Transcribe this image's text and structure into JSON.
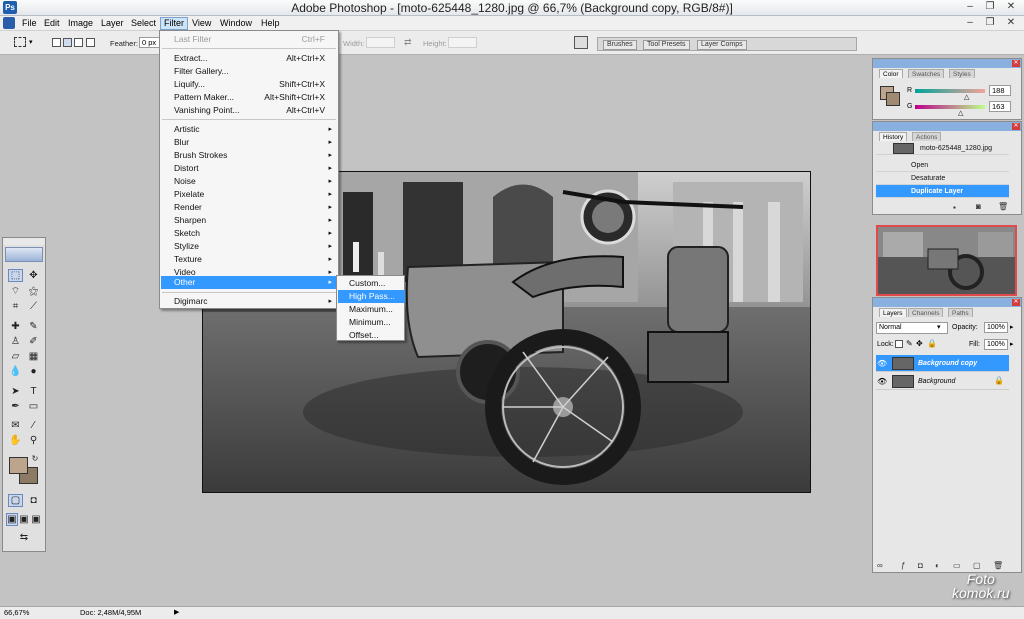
{
  "window": {
    "title": "Adobe Photoshop - [moto-625448_1280.jpg @ 66,7% (Background copy, RGB/8#)]",
    "logo": "Ps"
  },
  "menubar": [
    "File",
    "Edit",
    "Image",
    "Layer",
    "Select",
    "Filter",
    "View",
    "Window",
    "Help"
  ],
  "options": {
    "feather_label": "Feather:",
    "feather_value": "0 px",
    "width_label": "Width:",
    "height_label": "Height:"
  },
  "well_tabs": [
    "Brushes",
    "Tool Presets",
    "Layer Comps"
  ],
  "filter_menu": {
    "group1": [
      {
        "label": "Last Filter",
        "shortcut": "Ctrl+F"
      }
    ],
    "group2": [
      {
        "label": "Extract...",
        "shortcut": "Alt+Ctrl+X"
      },
      {
        "label": "Filter Gallery...",
        "shortcut": ""
      },
      {
        "label": "Liquify...",
        "shortcut": "Shift+Ctrl+X"
      },
      {
        "label": "Pattern Maker...",
        "shortcut": "Alt+Shift+Ctrl+X"
      },
      {
        "label": "Vanishing Point...",
        "shortcut": "Alt+Ctrl+V"
      }
    ],
    "group3": [
      "Artistic",
      "Blur",
      "Brush Strokes",
      "Distort",
      "Noise",
      "Pixelate",
      "Render",
      "Sharpen",
      "Sketch",
      "Stylize",
      "Texture",
      "Video",
      "Other"
    ],
    "group4": [
      "Digimarc"
    ]
  },
  "other_submenu": [
    "Custom...",
    "High Pass...",
    "Maximum...",
    "Minimum...",
    "Offset..."
  ],
  "color_panel": {
    "tabs": [
      "Color",
      "Swatches",
      "Styles"
    ],
    "r_label": "R",
    "r_value": "188",
    "g_label": "G",
    "g_value": "163",
    "foreground": "#bca58c"
  },
  "history_panel": {
    "tabs": [
      "History",
      "Actions"
    ],
    "snapshot": "moto-625448_1280.jpg",
    "steps": [
      "Open",
      "Desaturate",
      "Duplicate Layer"
    ]
  },
  "layers_panel": {
    "tabs": [
      "Layers",
      "Channels",
      "Paths"
    ],
    "blend": "Normal",
    "opacity_label": "Opacity:",
    "opacity": "100%",
    "lock_label": "Lock:",
    "fill_label": "Fill:",
    "fill": "100%",
    "layers": [
      "Background copy",
      "Background"
    ]
  },
  "status": {
    "zoom": "66,67%",
    "doc": "Doc: 2,48M/4,95M"
  },
  "watermark": {
    "line1": "Foto",
    "line2": "komok.ru"
  }
}
